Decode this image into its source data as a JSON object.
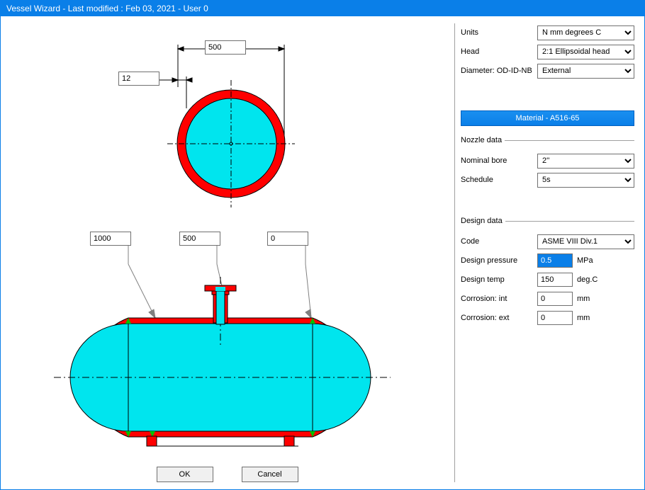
{
  "title": "Vessel Wizard - Last modified : Feb 03, 2021 - User 0",
  "dimensions": {
    "od": "500",
    "thk": "12",
    "length": "1000",
    "nozzle_pos": "500",
    "nozzle_off": "0"
  },
  "buttons": {
    "ok": "OK",
    "cancel": "Cancel"
  },
  "panel": {
    "units_label": "Units",
    "units_value": "N mm degrees C",
    "head_label": "Head",
    "head_value": "2:1 Ellipsoidal head",
    "diameter_label": "Diameter: OD-ID-NB",
    "diameter_value": "External",
    "material_button": "Material - A516-65",
    "nozzle_legend": "Nozzle data",
    "bore_label": "Nominal bore",
    "bore_value": "2''",
    "schedule_label": "Schedule",
    "schedule_value": "5s",
    "design_legend": "Design data",
    "code_label": "Code",
    "code_value": "ASME VIII Div.1",
    "pressure_label": "Design pressure",
    "pressure_value": "0.5",
    "pressure_unit": "MPa",
    "temp_label": "Design temp",
    "temp_value": "150",
    "temp_unit": "deg.C",
    "corr_int_label": "Corrosion: int",
    "corr_int_value": "0",
    "corr_int_unit": "mm",
    "corr_ext_label": "Corrosion: ext",
    "corr_ext_value": "0",
    "corr_ext_unit": "mm"
  }
}
